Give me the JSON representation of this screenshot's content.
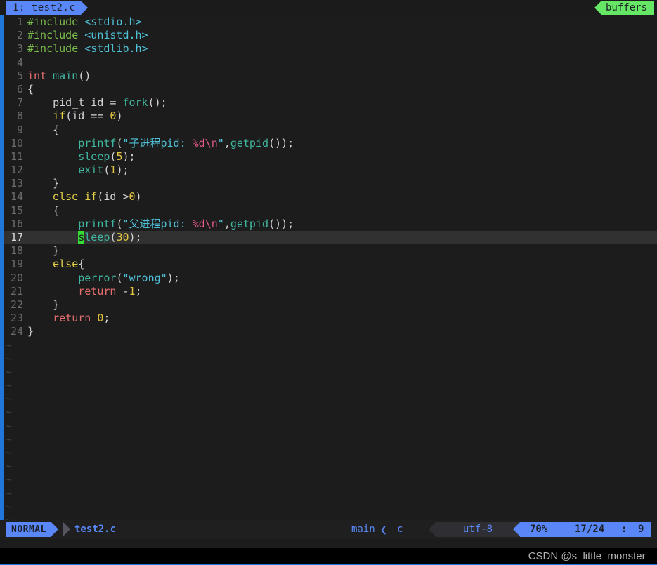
{
  "window": {
    "title": "test2.c",
    "colors": {
      "background": "#1c1c1c",
      "accent_blue": "#5a87f7",
      "accent_green": "#65e765",
      "cursor_green": "#33dd33",
      "cursorline": "#313131",
      "left_stripe": "#2176d9"
    }
  },
  "tabline": {
    "active_tab": "1: test2.c",
    "buffers_label": "buffers"
  },
  "buffer": {
    "lines": [
      {
        "num": "1",
        "tokens": [
          {
            "t": "#include ",
            "c": "s-pre"
          },
          {
            "t": "<stdio.h>",
            "c": "s-inc"
          }
        ]
      },
      {
        "num": "2",
        "tokens": [
          {
            "t": "#include ",
            "c": "s-pre"
          },
          {
            "t": "<unistd.h>",
            "c": "s-inc"
          }
        ]
      },
      {
        "num": "3",
        "tokens": [
          {
            "t": "#include ",
            "c": "s-pre"
          },
          {
            "t": "<stdlib.h>",
            "c": "s-inc"
          }
        ]
      },
      {
        "num": "4",
        "tokens": []
      },
      {
        "num": "5",
        "tokens": [
          {
            "t": "int ",
            "c": "s-type"
          },
          {
            "t": "main",
            "c": "s-func"
          },
          {
            "t": "()",
            "c": "s-plain"
          }
        ]
      },
      {
        "num": "6",
        "tokens": [
          {
            "t": "{",
            "c": "s-plain"
          }
        ]
      },
      {
        "num": "7",
        "tokens": [
          {
            "t": "    pid_t id = ",
            "c": "s-plain"
          },
          {
            "t": "fork",
            "c": "s-func"
          },
          {
            "t": "();",
            "c": "s-plain"
          }
        ]
      },
      {
        "num": "8",
        "tokens": [
          {
            "t": "    ",
            "c": "s-plain"
          },
          {
            "t": "if",
            "c": "s-kw"
          },
          {
            "t": "(id == ",
            "c": "s-plain"
          },
          {
            "t": "0",
            "c": "s-num"
          },
          {
            "t": ")",
            "c": "s-plain"
          }
        ]
      },
      {
        "num": "9",
        "tokens": [
          {
            "t": "    {",
            "c": "s-plain"
          }
        ]
      },
      {
        "num": "10",
        "tokens": [
          {
            "t": "        ",
            "c": "s-plain"
          },
          {
            "t": "printf",
            "c": "s-func"
          },
          {
            "t": "(",
            "c": "s-plain"
          },
          {
            "t": "\"子进程pid: ",
            "c": "s-str"
          },
          {
            "t": "%d\\n",
            "c": "s-esc"
          },
          {
            "t": "\"",
            "c": "s-str"
          },
          {
            "t": ",",
            "c": "s-plain"
          },
          {
            "t": "getpid",
            "c": "s-func"
          },
          {
            "t": "());",
            "c": "s-plain"
          }
        ]
      },
      {
        "num": "11",
        "tokens": [
          {
            "t": "        ",
            "c": "s-plain"
          },
          {
            "t": "sleep",
            "c": "s-func"
          },
          {
            "t": "(",
            "c": "s-plain"
          },
          {
            "t": "5",
            "c": "s-num"
          },
          {
            "t": ");",
            "c": "s-plain"
          }
        ]
      },
      {
        "num": "12",
        "tokens": [
          {
            "t": "        ",
            "c": "s-plain"
          },
          {
            "t": "exit",
            "c": "s-func"
          },
          {
            "t": "(",
            "c": "s-plain"
          },
          {
            "t": "1",
            "c": "s-num"
          },
          {
            "t": ");",
            "c": "s-plain"
          }
        ]
      },
      {
        "num": "13",
        "tokens": [
          {
            "t": "    }",
            "c": "s-plain"
          }
        ]
      },
      {
        "num": "14",
        "tokens": [
          {
            "t": "    ",
            "c": "s-plain"
          },
          {
            "t": "else if",
            "c": "s-kw"
          },
          {
            "t": "(id >",
            "c": "s-plain"
          },
          {
            "t": "0",
            "c": "s-num"
          },
          {
            "t": ")",
            "c": "s-plain"
          }
        ]
      },
      {
        "num": "15",
        "tokens": [
          {
            "t": "    {",
            "c": "s-plain"
          }
        ]
      },
      {
        "num": "16",
        "tokens": [
          {
            "t": "        ",
            "c": "s-plain"
          },
          {
            "t": "printf",
            "c": "s-func"
          },
          {
            "t": "(",
            "c": "s-plain"
          },
          {
            "t": "\"父进程pid: ",
            "c": "s-str"
          },
          {
            "t": "%d\\n",
            "c": "s-esc"
          },
          {
            "t": "\"",
            "c": "s-str"
          },
          {
            "t": ",",
            "c": "s-plain"
          },
          {
            "t": "getpid",
            "c": "s-func"
          },
          {
            "t": "());",
            "c": "s-plain"
          }
        ]
      },
      {
        "num": "17",
        "cursorline": true,
        "tokens": [
          {
            "t": "        ",
            "c": "s-plain"
          },
          {
            "t": "s",
            "c": "s-func cursor-block"
          },
          {
            "t": "leep",
            "c": "s-func"
          },
          {
            "t": "(",
            "c": "s-plain"
          },
          {
            "t": "30",
            "c": "s-num"
          },
          {
            "t": ");",
            "c": "s-plain"
          }
        ]
      },
      {
        "num": "18",
        "tokens": [
          {
            "t": "    }",
            "c": "s-plain"
          }
        ]
      },
      {
        "num": "19",
        "tokens": [
          {
            "t": "    ",
            "c": "s-plain"
          },
          {
            "t": "else",
            "c": "s-kw"
          },
          {
            "t": "{",
            "c": "s-plain"
          }
        ]
      },
      {
        "num": "20",
        "tokens": [
          {
            "t": "        ",
            "c": "s-plain"
          },
          {
            "t": "perror",
            "c": "s-func"
          },
          {
            "t": "(",
            "c": "s-plain"
          },
          {
            "t": "\"wrong\"",
            "c": "s-str"
          },
          {
            "t": ");",
            "c": "s-plain"
          }
        ]
      },
      {
        "num": "21",
        "tokens": [
          {
            "t": "        ",
            "c": "s-plain"
          },
          {
            "t": "return",
            "c": "s-type"
          },
          {
            "t": " -",
            "c": "s-plain"
          },
          {
            "t": "1",
            "c": "s-num"
          },
          {
            "t": ";",
            "c": "s-plain"
          }
        ]
      },
      {
        "num": "22",
        "tokens": [
          {
            "t": "    }",
            "c": "s-plain"
          }
        ]
      },
      {
        "num": "23",
        "tokens": [
          {
            "t": "    ",
            "c": "s-plain"
          },
          {
            "t": "return",
            "c": "s-type"
          },
          {
            "t": " ",
            "c": "s-plain"
          },
          {
            "t": "0",
            "c": "s-num"
          },
          {
            "t": ";",
            "c": "s-plain"
          }
        ]
      },
      {
        "num": "24",
        "tokens": [
          {
            "t": "}",
            "c": "s-plain"
          }
        ]
      }
    ],
    "filler_char": "~",
    "filler_count": 14
  },
  "statusline": {
    "mode": "NORMAL",
    "filename": "test2.c",
    "function": "main",
    "separator_icon": "chevron-left",
    "filetype": "c",
    "encoding": "utf-8",
    "percent": "70%",
    "line_position": "17/24",
    "colon": ":",
    "column": "9"
  },
  "watermark": {
    "text": "CSDN @s_little_monster_"
  }
}
